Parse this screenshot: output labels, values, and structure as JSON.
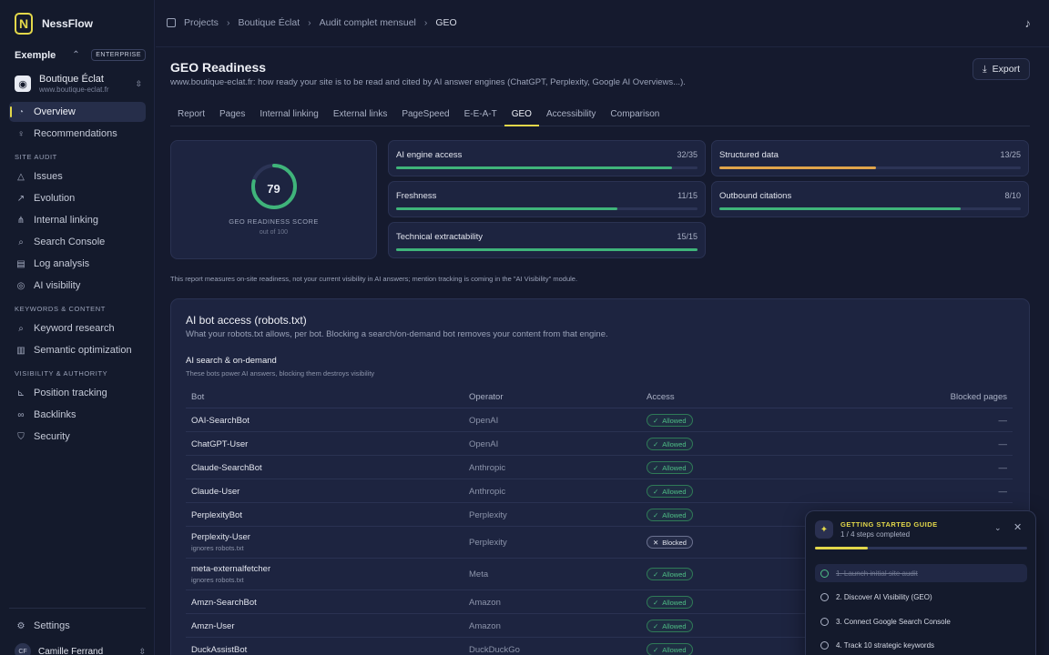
{
  "app": {
    "name": "NessFlow",
    "logo_letter": "N"
  },
  "workspace": {
    "name": "Exemple",
    "plan": "ENTERPRISE"
  },
  "site": {
    "name": "Boutique Éclat",
    "url": "www.boutique-eclat.fr"
  },
  "nav": {
    "overview": "Overview",
    "recommendations": "Recommendations",
    "section_site_audit": "SITE AUDIT",
    "issues": "Issues",
    "evolution": "Evolution",
    "internal_linking": "Internal linking",
    "search_console": "Search Console",
    "log_analysis": "Log analysis",
    "ai_visibility": "AI visibility",
    "section_keywords": "KEYWORDS & CONTENT",
    "keyword_research": "Keyword research",
    "semantic_optimization": "Semantic optimization",
    "section_visibility": "VISIBILITY & AUTHORITY",
    "position_tracking": "Position tracking",
    "backlinks": "Backlinks",
    "security": "Security",
    "settings": "Settings"
  },
  "user": {
    "initials": "CF",
    "name": "Camille Ferrand"
  },
  "breadcrumb": [
    "Projects",
    "Boutique Éclat",
    "Audit complet mensuel",
    "GEO"
  ],
  "page": {
    "title": "GEO Readiness",
    "subtitle": "www.boutique-eclat.fr: how ready your site is to be read and cited by AI answer engines (ChatGPT, Perplexity, Google AI Overviews...).",
    "export_label": "Export"
  },
  "tabs": [
    "Report",
    "Pages",
    "Internal linking",
    "External links",
    "PageSpeed",
    "E-E-A-T",
    "GEO",
    "Accessibility",
    "Comparison"
  ],
  "active_tab": "GEO",
  "score": {
    "value": "79",
    "fraction": 0.79,
    "label": "GEO READINESS SCORE",
    "out_of": "out of 100"
  },
  "metrics": {
    "ai_engine_access": {
      "label": "AI engine access",
      "value": "32/35",
      "fraction": 0.914,
      "color": "#3fb47a"
    },
    "structured_data": {
      "label": "Structured data",
      "value": "13/25",
      "fraction": 0.52,
      "color": "#e0a44a"
    },
    "freshness": {
      "label": "Freshness",
      "value": "11/15",
      "fraction": 0.733,
      "color": "#3fb47a"
    },
    "outbound_citations": {
      "label": "Outbound citations",
      "value": "8/10",
      "fraction": 0.8,
      "color": "#3fb47a"
    },
    "technical_extractability": {
      "label": "Technical extractability",
      "value": "15/15",
      "fraction": 1.0,
      "color": "#3fb47a"
    }
  },
  "footnote": "This report measures on-site readiness, not your current visibility in AI answers; mention tracking is coming in the \"AI Visibility\" module.",
  "bot_access": {
    "title": "AI bot access (robots.txt)",
    "subtitle": "What your robots.txt allows, per bot. Blocking a search/on-demand bot removes your content from that engine.",
    "group_title": "AI search & on-demand",
    "group_subtitle": "These bots power AI answers, blocking them destroys visibility",
    "columns": {
      "bot": "Bot",
      "operator": "Operator",
      "access": "Access",
      "blocked": "Blocked pages"
    },
    "rows": [
      {
        "bot": "OAI-SearchBot",
        "operator": "OpenAI",
        "access": "Allowed",
        "blocked": "—"
      },
      {
        "bot": "ChatGPT-User",
        "operator": "OpenAI",
        "access": "Allowed",
        "blocked": "—"
      },
      {
        "bot": "Claude-SearchBot",
        "operator": "Anthropic",
        "access": "Allowed",
        "blocked": "—"
      },
      {
        "bot": "Claude-User",
        "operator": "Anthropic",
        "access": "Allowed",
        "blocked": "—"
      },
      {
        "bot": "PerplexityBot",
        "operator": "Perplexity",
        "access": "Allowed",
        "blocked": ""
      },
      {
        "bot": "Perplexity-User",
        "note": "ignores robots.txt",
        "operator": "Perplexity",
        "access": "Blocked",
        "blocked": ""
      },
      {
        "bot": "meta-externalfetcher",
        "note": "ignores robots.txt",
        "operator": "Meta",
        "access": "Allowed",
        "blocked": ""
      },
      {
        "bot": "Amzn-SearchBot",
        "operator": "Amazon",
        "access": "Allowed",
        "blocked": ""
      },
      {
        "bot": "Amzn-User",
        "operator": "Amazon",
        "access": "Allowed",
        "blocked": ""
      },
      {
        "bot": "DuckAssistBot",
        "operator": "DuckDuckGo",
        "access": "Allowed",
        "blocked": ""
      }
    ]
  },
  "guide": {
    "title": "GETTING STARTED GUIDE",
    "progress": "1 / 4 steps completed",
    "fraction": 0.25,
    "steps": [
      "1. Launch initial site audit",
      "2. Discover AI Visibility (GEO)",
      "3. Connect Google Search Console",
      "4. Track 10 strategic keywords"
    ]
  },
  "colors": {
    "accent": "#e3d84a",
    "allowed": "#4fbf86",
    "background": "#151a2e"
  }
}
